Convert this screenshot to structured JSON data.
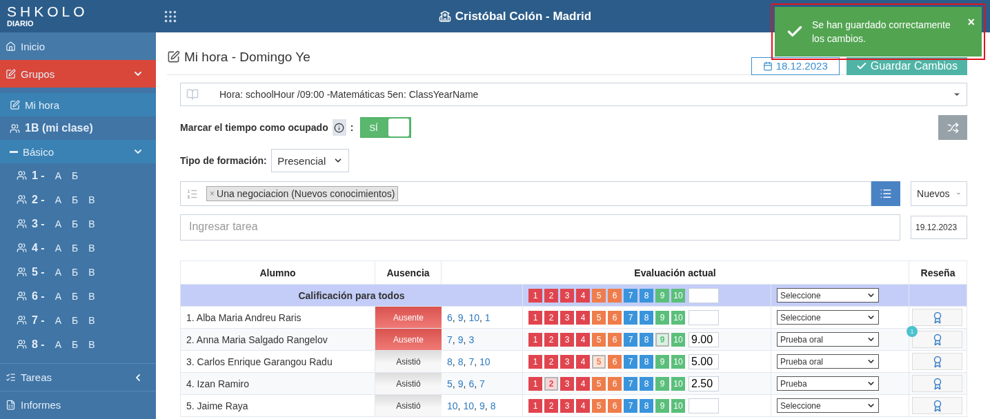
{
  "header": {
    "logo": "SHKOLO",
    "logo_sub": "DIARIO",
    "school": "Cristóbal Colón - Madrid"
  },
  "toast": {
    "message": "Se han guardado correctamente los cambios.",
    "close": "×"
  },
  "sidebar": {
    "items": [
      {
        "kind": "home",
        "label": "Inicio"
      },
      {
        "kind": "groups",
        "label": "Grupos",
        "selected": true,
        "expanded": true,
        "children": [
          {
            "kind": "myhour",
            "label": "Mi hora",
            "selected": true
          },
          {
            "kind": "myclass",
            "label": "1B (mi clase)"
          },
          {
            "kind": "level",
            "label": "Básico",
            "expanded": true,
            "children": [
              {
                "number": "1 -",
                "letters": [
                  "А",
                  "Б"
                ]
              },
              {
                "number": "2 -",
                "letters": [
                  "А",
                  "Б",
                  "В"
                ]
              },
              {
                "number": "3 -",
                "letters": [
                  "А",
                  "Б",
                  "В"
                ]
              },
              {
                "number": "4 -",
                "letters": [
                  "А",
                  "Б",
                  "В"
                ]
              },
              {
                "number": "5 -",
                "letters": [
                  "А",
                  "Б",
                  "В"
                ]
              },
              {
                "number": "6 -",
                "letters": [
                  "А",
                  "Б",
                  "В"
                ]
              },
              {
                "number": "7 -",
                "letters": [
                  "А",
                  "Б",
                  "В"
                ]
              },
              {
                "number": "8 -",
                "letters": [
                  "А",
                  "Б",
                  "В"
                ]
              }
            ]
          }
        ]
      },
      {
        "kind": "tasks",
        "label": "Tareas",
        "expanded": false
      },
      {
        "kind": "reports",
        "label": "Informes"
      }
    ]
  },
  "page": {
    "title": "Mi hora - Domingo Ye",
    "date": "18.12.2023",
    "save": "Guardar Cambios"
  },
  "hour_select": {
    "value": "Hora: schoolHour /09:00 -Matemáticas 5en: ClassYearName"
  },
  "busy": {
    "label": "Marcar el tiempo como ocupado",
    "separator": ":",
    "toggle": {
      "label": "SÍ",
      "on": true
    }
  },
  "training": {
    "label": "Tipo de formación:",
    "value": "Presencial"
  },
  "topics": {
    "tags": [
      "Una negociacion (Nuevos conocimientos)"
    ],
    "tag_remove": "×",
    "type": "Nuevos"
  },
  "homework": {
    "placeholder": "Ingresar tarea",
    "date": "19.12.2023"
  },
  "table": {
    "columns": [
      "Alumno",
      "Ausencia",
      "Evaluación actual",
      "Reseña"
    ],
    "all_row": {
      "label": "Calificación para todos",
      "type": "Seleccione",
      "grades": [
        {
          "label": "1",
          "color": "#e0454f",
          "selected": false
        },
        {
          "label": "2",
          "color": "#e0454f",
          "selected": false
        },
        {
          "label": "3",
          "color": "#e0454f",
          "selected": false
        },
        {
          "label": "4",
          "color": "#e0454f",
          "selected": false
        },
        {
          "label": "5",
          "color": "#ef7d4b",
          "selected": false
        },
        {
          "label": "6",
          "color": "#ef7d4b",
          "selected": false
        },
        {
          "label": "7",
          "color": "#3a94dc",
          "selected": false
        },
        {
          "label": "8",
          "color": "#3a94dc",
          "selected": false
        },
        {
          "label": "9",
          "color": "#5bbf7b",
          "selected": false
        },
        {
          "label": "10",
          "color": "#5bbf7b",
          "selected": false
        }
      ]
    },
    "rows": [
      {
        "name": "1. Alba Maria Andreu Raris",
        "absence": {
          "label": "Ausente",
          "absent": true
        },
        "marks": [
          {
            "value": "6",
            "separator": ","
          },
          {
            "value": "9",
            "separator": ","
          },
          {
            "value": "10",
            "separator": ","
          },
          {
            "value": "1"
          }
        ],
        "type": "Seleccione",
        "grades": [
          {
            "label": "1",
            "color": "#e0454f",
            "selected": false
          },
          {
            "label": "2",
            "color": "#e0454f",
            "selected": false
          },
          {
            "label": "3",
            "color": "#e0454f",
            "selected": false
          },
          {
            "label": "4",
            "color": "#e0454f",
            "selected": false
          },
          {
            "label": "5",
            "color": "#ef7d4b",
            "selected": false
          },
          {
            "label": "6",
            "color": "#ef7d4b",
            "selected": false
          },
          {
            "label": "7",
            "color": "#3a94dc",
            "selected": false
          },
          {
            "label": "8",
            "color": "#3a94dc",
            "selected": false
          },
          {
            "label": "9",
            "color": "#5bbf7b",
            "selected": false
          },
          {
            "label": "10",
            "color": "#5bbf7b",
            "selected": false
          }
        ]
      },
      {
        "name": "2. Anna Maria Salgado Rangelov",
        "absence": {
          "label": "Ausente",
          "absent": true
        },
        "marks": [
          {
            "value": "7",
            "separator": ","
          },
          {
            "value": "9",
            "separator": ","
          },
          {
            "value": "3"
          }
        ],
        "value": "9.00",
        "type": "Prueba oral",
        "review_count": "1",
        "grades": [
          {
            "label": "1",
            "color": "#e0454f",
            "selected": false
          },
          {
            "label": "2",
            "color": "#e0454f",
            "selected": false
          },
          {
            "label": "3",
            "color": "#e0454f",
            "selected": false
          },
          {
            "label": "4",
            "color": "#e0454f",
            "selected": false
          },
          {
            "label": "5",
            "color": "#ef7d4b",
            "selected": false
          },
          {
            "label": "6",
            "color": "#ef7d4b",
            "selected": false
          },
          {
            "label": "7",
            "color": "#3a94dc",
            "selected": false
          },
          {
            "label": "8",
            "color": "#3a94dc",
            "selected": false
          },
          {
            "label": "9",
            "color": "#5bbf7b",
            "selected": true
          },
          {
            "label": "10",
            "color": "#5bbf7b",
            "selected": false
          }
        ]
      },
      {
        "name": "3. Carlos Enrique Garangou Radu",
        "absence": {
          "label": "Asistió",
          "absent": false
        },
        "marks": [
          {
            "value": "8",
            "separator": ","
          },
          {
            "value": "8",
            "separator": ","
          },
          {
            "value": "7",
            "separator": ","
          },
          {
            "value": "10"
          }
        ],
        "value": "5.00",
        "type": "Prueba oral",
        "grades": [
          {
            "label": "1",
            "color": "#e0454f",
            "selected": false
          },
          {
            "label": "2",
            "color": "#e0454f",
            "selected": false
          },
          {
            "label": "3",
            "color": "#e0454f",
            "selected": false
          },
          {
            "label": "4",
            "color": "#e0454f",
            "selected": false
          },
          {
            "label": "5",
            "color": "#ef7d4b",
            "selected": true
          },
          {
            "label": "6",
            "color": "#ef7d4b",
            "selected": false
          },
          {
            "label": "7",
            "color": "#3a94dc",
            "selected": false
          },
          {
            "label": "8",
            "color": "#3a94dc",
            "selected": false
          },
          {
            "label": "9",
            "color": "#5bbf7b",
            "selected": false
          },
          {
            "label": "10",
            "color": "#5bbf7b",
            "selected": false
          }
        ]
      },
      {
        "name": "4. Izan Ramiro",
        "absence": {
          "label": "Asistió",
          "absent": false
        },
        "marks": [
          {
            "value": "5",
            "separator": ","
          },
          {
            "value": "9",
            "separator": ","
          },
          {
            "value": "6",
            "separator": ","
          },
          {
            "value": "7"
          }
        ],
        "value": "2.50",
        "type": "Prueba",
        "grades": [
          {
            "label": "1",
            "color": "#e0454f",
            "selected": false
          },
          {
            "label": "2",
            "color": "#e0454f",
            "selected": true
          },
          {
            "label": "3",
            "color": "#e0454f",
            "selected": false
          },
          {
            "label": "4",
            "color": "#e0454f",
            "selected": false
          },
          {
            "label": "5",
            "color": "#ef7d4b",
            "selected": false
          },
          {
            "label": "6",
            "color": "#ef7d4b",
            "selected": false
          },
          {
            "label": "7",
            "color": "#3a94dc",
            "selected": false
          },
          {
            "label": "8",
            "color": "#3a94dc",
            "selected": false
          },
          {
            "label": "9",
            "color": "#5bbf7b",
            "selected": false
          },
          {
            "label": "10",
            "color": "#5bbf7b",
            "selected": false
          }
        ]
      },
      {
        "name": "5. Jaime Raya",
        "absence": {
          "label": "Asistió",
          "absent": false
        },
        "marks": [
          {
            "value": "10",
            "separator": ","
          },
          {
            "value": "10",
            "separator": ","
          },
          {
            "value": "9",
            "separator": ","
          },
          {
            "value": "8"
          }
        ],
        "type": "Seleccione",
        "grades": [
          {
            "label": "1",
            "color": "#e0454f",
            "selected": false
          },
          {
            "label": "2",
            "color": "#e0454f",
            "selected": false
          },
          {
            "label": "3",
            "color": "#e0454f",
            "selected": false
          },
          {
            "label": "4",
            "color": "#e0454f",
            "selected": false
          },
          {
            "label": "5",
            "color": "#ef7d4b",
            "selected": false
          },
          {
            "label": "6",
            "color": "#ef7d4b",
            "selected": false
          },
          {
            "label": "7",
            "color": "#3a94dc",
            "selected": false
          },
          {
            "label": "8",
            "color": "#3a94dc",
            "selected": false
          },
          {
            "label": "9",
            "color": "#5bbf7b",
            "selected": false
          },
          {
            "label": "10",
            "color": "#5bbf7b",
            "selected": false
          }
        ]
      }
    ]
  }
}
